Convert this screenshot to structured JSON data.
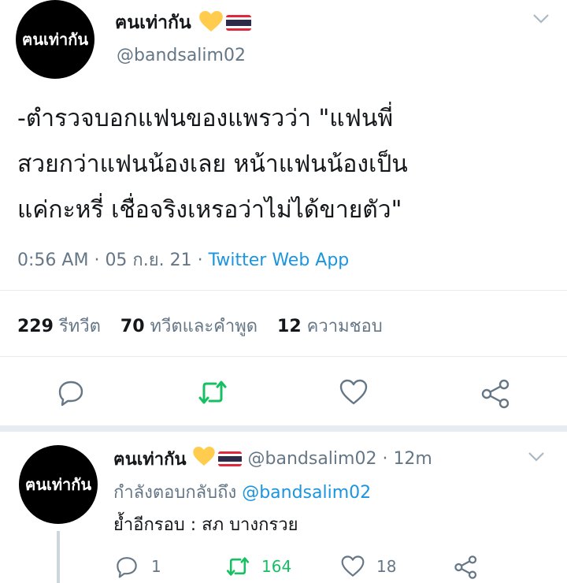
{
  "main_tweet": {
    "avatar_text": "ฅนเท่ากัน",
    "display_name": "ฅนเท่ากัน",
    "handle": "@bandsalim02",
    "text_lines": [
      "-ตำรวจบอกแฟนของแพรวว่า \"แฟนพี่",
      "สวยกว่าแฟนน้องเลย หน้าแฟนน้องเป็น",
      "แค่กะหรี่ เชื่อจริงเหรอว่าไม่ได้ขายตัว\""
    ],
    "time": "0:56 AM",
    "date": "05 ก.ย. 21",
    "source": "Twitter Web App",
    "stats": {
      "retweets_count": "229",
      "retweets_label": "รีทวีต",
      "quotes_count": "70",
      "quotes_label": "ทวีตและคำพูด",
      "likes_count": "12",
      "likes_label": "ความชอบ"
    }
  },
  "reply_tweet": {
    "avatar_text": "ฅนเท่ากัน",
    "display_name": "ฅนเท่ากัน",
    "handle": "@bandsalim02",
    "age": "12m",
    "replying_prefix": "กำลังตอบกลับถึง",
    "replying_to": "@bandsalim02",
    "text": "ย้ำอีกรอบ : สภ บางกรวย",
    "reply_count": "1",
    "retweet_count": "164",
    "like_count": "18"
  },
  "colors": {
    "retweet_green": "#17bf63",
    "link_blue": "#1b95e0",
    "icon_gray": "#657786",
    "heart_yellow": "#ffcc4d"
  }
}
